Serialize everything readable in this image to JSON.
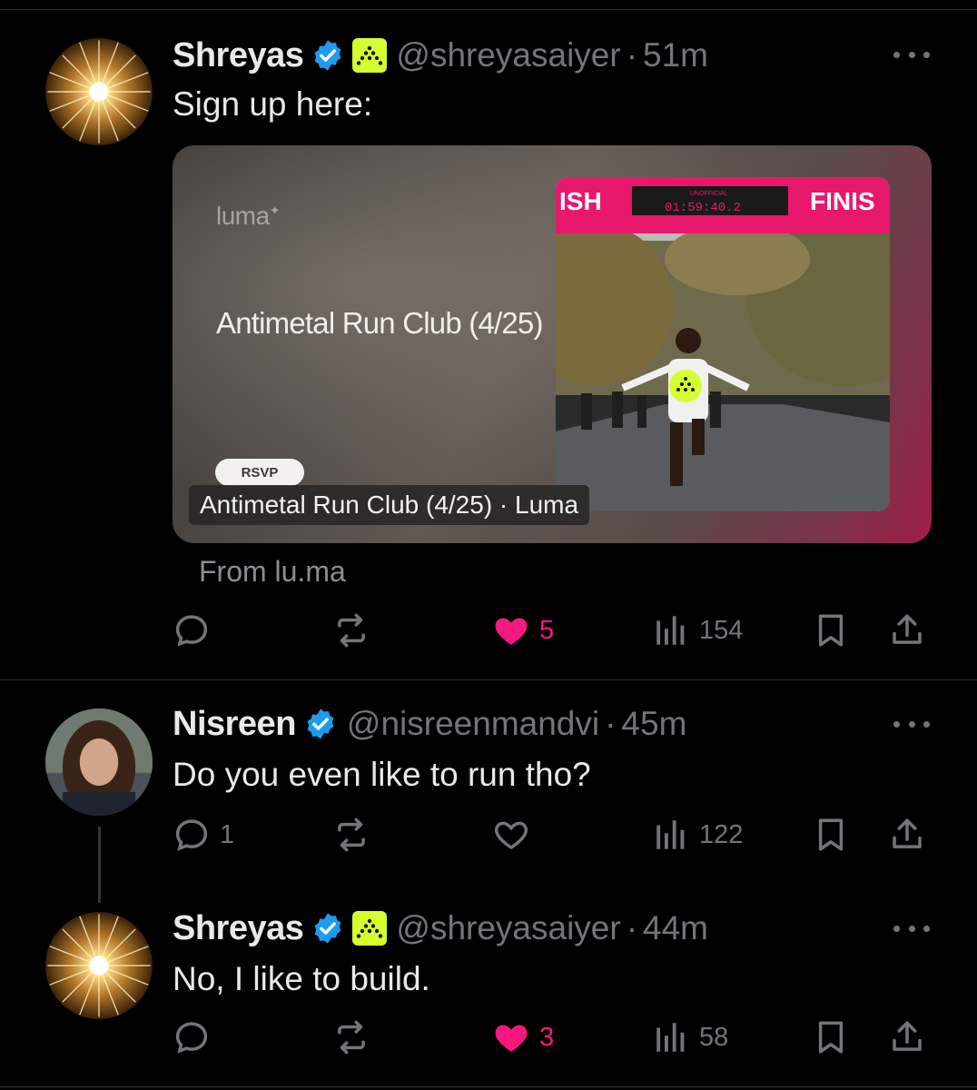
{
  "tweets": [
    {
      "name": "Shreyas",
      "handle": "@shreyasaiyer",
      "sep": "·",
      "time": "51m",
      "text": "Sign up here:",
      "card": {
        "logo": "luma",
        "title": "Antimetal Run Club (4/25)",
        "button": "RSVP",
        "caption": "Antimetal Run Club (4/25) · Luma",
        "source": "From lu.ma",
        "photo": {
          "left_banner": "ISH",
          "right_banner": "FINIS",
          "clock_label": "UNOFFICIAL",
          "clock": "01:59:40.2"
        }
      },
      "stats": {
        "replies": "",
        "retweets": "",
        "likes": "5",
        "views": "154"
      },
      "liked": true
    },
    {
      "name": "Nisreen",
      "handle": "@nisreenmandvi",
      "sep": "·",
      "time": "45m",
      "text": "Do you even like to run tho?",
      "stats": {
        "replies": "1",
        "retweets": "",
        "likes": "",
        "views": "122"
      },
      "liked": false
    },
    {
      "name": "Shreyas",
      "handle": "@shreyasaiyer",
      "sep": "·",
      "time": "44m",
      "text": "No, I like to build.",
      "stats": {
        "replies": "",
        "retweets": "",
        "likes": "3",
        "views": "58"
      },
      "liked": true
    }
  ],
  "colors": {
    "background": "#000000",
    "text": "#e7e9ea",
    "muted": "#71767b",
    "like": "#f91880",
    "verified": "#1d9bf0",
    "affiliation": "#d5ff2f"
  },
  "icons": [
    "reply-icon",
    "retweet-icon",
    "like-icon",
    "views-icon",
    "bookmark-icon",
    "share-icon",
    "verified-badge-icon",
    "more-icon"
  ]
}
